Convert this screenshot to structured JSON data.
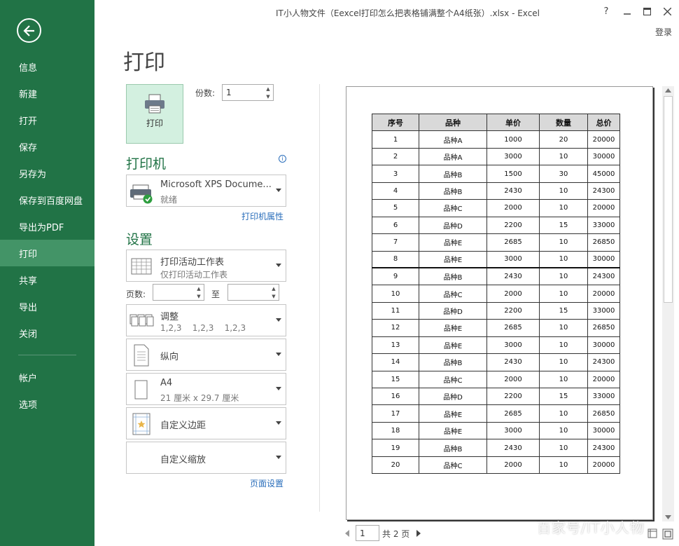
{
  "window": {
    "title": "IT小人物文件（Eexcel打印怎么把表格铺满整个A4纸张）.xlsx - Excel",
    "help": "?",
    "login": "登录"
  },
  "sidebar": {
    "items": [
      {
        "label": "信息"
      },
      {
        "label": "新建"
      },
      {
        "label": "打开"
      },
      {
        "label": "保存"
      },
      {
        "label": "另存为"
      },
      {
        "label": "保存到百度网盘"
      },
      {
        "label": "导出为PDF"
      },
      {
        "label": "打印"
      },
      {
        "label": "共享"
      },
      {
        "label": "导出"
      },
      {
        "label": "关闭"
      }
    ],
    "bottom_items": [
      {
        "label": "帐户"
      },
      {
        "label": "选项"
      }
    ]
  },
  "page_title": "打印",
  "print_button_label": "打印",
  "copies": {
    "label": "份数:",
    "value": "1"
  },
  "printer": {
    "heading": "打印机",
    "name": "Microsoft XPS Docume...",
    "status": "就绪",
    "properties_link": "打印机属性"
  },
  "settings": {
    "heading": "设置",
    "scope": {
      "title": "打印活动工作表",
      "subtitle": "仅打印活动工作表"
    },
    "pages_label": "页数:",
    "to_label": "至",
    "collate": {
      "title": "调整",
      "subtitle": "1,2,3    1,2,3    1,2,3"
    },
    "orientation": {
      "title": "纵向"
    },
    "paper": {
      "title": "A4",
      "subtitle": "21 厘米 x 29.7 厘米"
    },
    "margins": {
      "title": "自定义边距"
    },
    "scaling": {
      "title": "自定义缩放"
    },
    "page_setup_link": "页面设置"
  },
  "preview": {
    "headers": [
      "序号",
      "品种",
      "单价",
      "数量",
      "总价"
    ],
    "rows": [
      [
        "1",
        "品种A",
        "1000",
        "20",
        "20000"
      ],
      [
        "2",
        "品种A",
        "3000",
        "10",
        "30000"
      ],
      [
        "3",
        "品种B",
        "1500",
        "30",
        "45000"
      ],
      [
        "4",
        "品种B",
        "2430",
        "10",
        "24300"
      ],
      [
        "5",
        "品种C",
        "2000",
        "10",
        "20000"
      ],
      [
        "6",
        "品种D",
        "2200",
        "15",
        "33000"
      ],
      [
        "7",
        "品种E",
        "2685",
        "10",
        "26850"
      ],
      [
        "8",
        "品种E",
        "3000",
        "10",
        "30000"
      ],
      [
        "9",
        "品种B",
        "2430",
        "10",
        "24300"
      ],
      [
        "10",
        "品种C",
        "2000",
        "10",
        "20000"
      ],
      [
        "11",
        "品种D",
        "2200",
        "15",
        "33000"
      ],
      [
        "12",
        "品种E",
        "2685",
        "10",
        "26850"
      ],
      [
        "13",
        "品种E",
        "3000",
        "10",
        "30000"
      ],
      [
        "14",
        "品种B",
        "2430",
        "10",
        "24300"
      ],
      [
        "15",
        "品种C",
        "2000",
        "10",
        "20000"
      ],
      [
        "16",
        "品种D",
        "2200",
        "15",
        "33000"
      ],
      [
        "17",
        "品种E",
        "2685",
        "10",
        "26850"
      ],
      [
        "18",
        "品种E",
        "3000",
        "10",
        "30000"
      ],
      [
        "19",
        "品种B",
        "2430",
        "10",
        "24300"
      ],
      [
        "20",
        "品种C",
        "2000",
        "10",
        "20000"
      ]
    ],
    "current_page": "1",
    "total_pages_label": "共 2 页"
  },
  "watermark": "百家号/IT小人物",
  "colors": {
    "accent": "#217346",
    "active_nav": "#439467",
    "link": "#2a6ebb"
  }
}
